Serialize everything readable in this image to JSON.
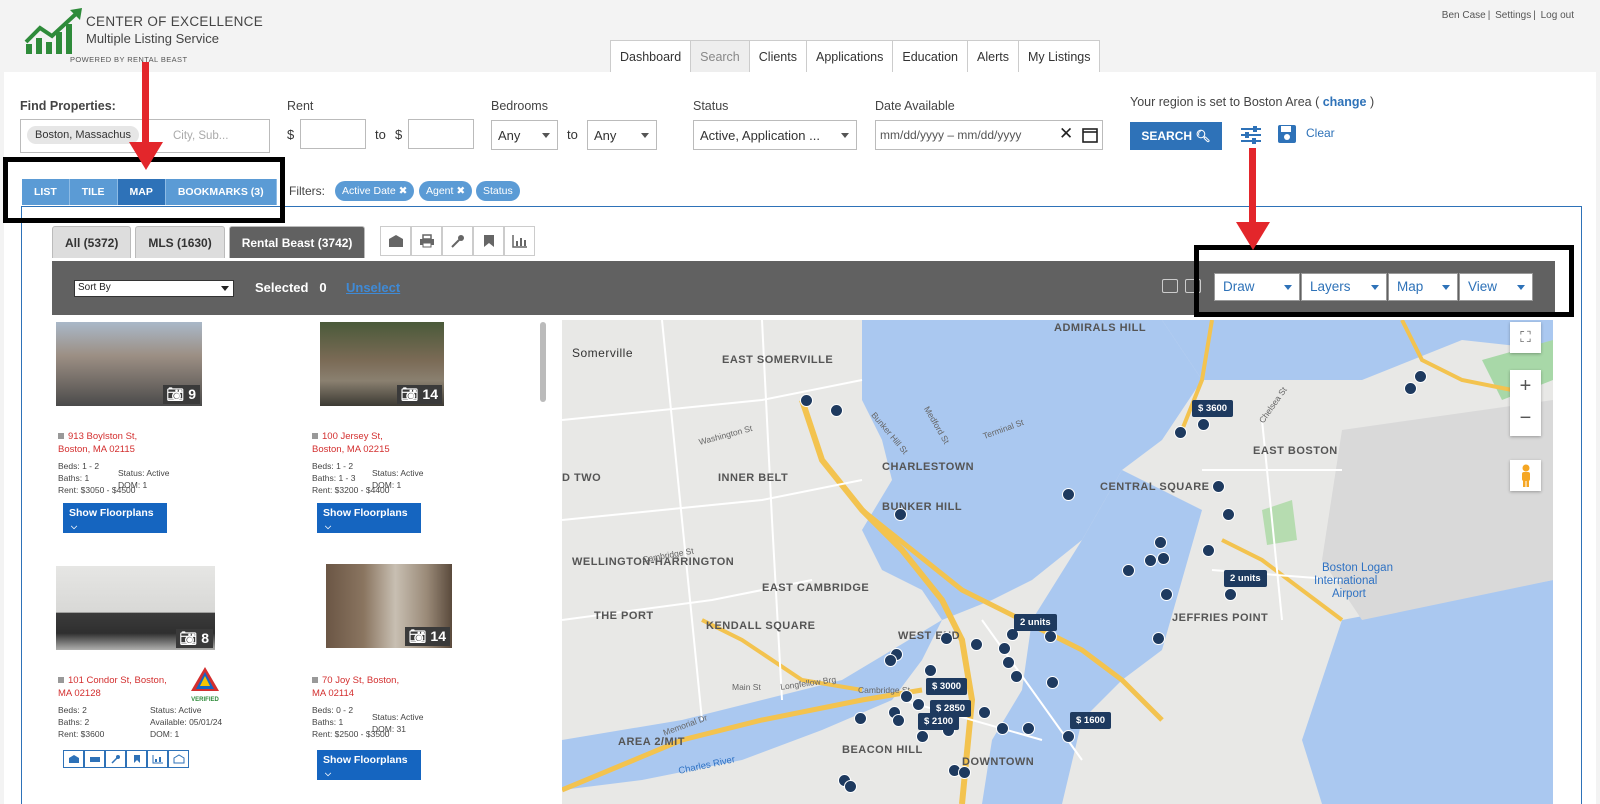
{
  "brand": {
    "name_line1": "CENTER OF EXCELLENCE",
    "name_line2": "Multiple Listing Service",
    "powered": "POWERED BY RENTAL BEAST"
  },
  "user_links": [
    "Ben Case",
    "Settings",
    "Log out"
  ],
  "nav_tabs": [
    "Dashboard",
    "Search",
    "Clients",
    "Applications",
    "Education",
    "Alerts",
    "My Listings"
  ],
  "search": {
    "find_label": "Find Properties:",
    "location_chip": "Boston, Massachus",
    "location_placeholder": "City, Sub...",
    "rent_label": "Rent",
    "currency": "$",
    "to": "to",
    "bedrooms_label": "Bedrooms",
    "bedrooms_min": "Any",
    "bedrooms_max": "Any",
    "status_label": "Status",
    "status_value": "Active, Application ...",
    "date_label": "Date Available",
    "date_placeholder": "mm/dd/yyyy – mm/dd/yyyy",
    "region_text": "Your region is set to Boston Area (",
    "region_link": "change",
    "region_close": ")",
    "search_button": "SEARCH",
    "clear": "Clear"
  },
  "view_tabs": [
    "LIST",
    "TILE",
    "MAP",
    "BOOKMARKS (3)"
  ],
  "filters": {
    "label": "Filters:",
    "chips": [
      "Active Date ✖",
      "Agent ✖",
      "Status"
    ]
  },
  "count_tabs": [
    "All (5372)",
    "MLS (1630)",
    "Rental Beast (3742)"
  ],
  "toolbar": {
    "sort_by": "Sort By",
    "selected": "Selected",
    "selected_count": "0",
    "unselect": "Unselect",
    "map_dropdowns": [
      "Draw",
      "Layers",
      "Map",
      "View"
    ]
  },
  "listings": [
    {
      "photos": "9",
      "address1": "913 Boylston St,",
      "address2": "Boston, MA 02115",
      "beds": "Beds: 1 - 2",
      "baths": "Baths: 1",
      "rent": "Rent: $3050 - $4500",
      "status": "Status: Active",
      "dom": "DOM: 1",
      "button": "Show Floorplans"
    },
    {
      "photos": "14",
      "address1": "100 Jersey St,",
      "address2": "Boston, MA 02215",
      "beds": "Beds: 1 - 2",
      "baths": "Baths: 1 - 3",
      "rent": "Rent: $3200 - $4400",
      "status": "Status: Active",
      "dom": "DOM: 1",
      "button": "Show Floorplans"
    },
    {
      "photos": "8",
      "address1": "101 Condor St, Boston,",
      "address2": "MA 02128",
      "beds": "Beds: 2",
      "baths": "Baths: 2",
      "rent": "Rent: $3600",
      "status": "Status: Active",
      "available": "Available: 05/01/24",
      "dom": "DOM: 1",
      "badge": "VERIFIED"
    },
    {
      "photos": "14",
      "address1": "70 Joy St, Boston,",
      "address2": "MA 02114",
      "beds": "Beds: 0 - 2",
      "baths": "Baths: 1",
      "rent": "Rent: $2500 - $3500",
      "status": "Status: Active",
      "dom": "DOM: 31",
      "button": "Show Floorplans"
    }
  ],
  "map": {
    "labels": [
      "Somerville",
      "EAST SOMERVILLE",
      "ADMIRALS HILL",
      "CHARLESTOWN",
      "INNER BELT",
      "BUNKER HILL",
      "EAST BOSTON",
      "CENTRAL SQUARE",
      "WELLINGTON-HARRINGTON",
      "EAST CAMBRIDGE",
      "THE PORT",
      "KENDALL SQUARE",
      "WEST END",
      "JEFFRIES POINT",
      "AREA 2/MIT",
      "BEACON HILL",
      "DOWNTOWN",
      "D TWO",
      "Boston Logan",
      "International",
      "Airport",
      "Charles River",
      "Main St",
      "Longfellow Brg",
      "Memorial Dr",
      "Cambridge St",
      "Medford St",
      "Terminal St",
      "Bunker Hill St",
      "Washington St",
      "Cambridge St",
      "Chelsea St"
    ],
    "price_tags": [
      "$ 3600",
      "2 units",
      "2 units",
      "$ 3000",
      "$ 2850",
      "$ 2100",
      "$ 1600"
    ]
  },
  "colors": {
    "primary": "#2e72b8",
    "tab_light": "#5b9bd5",
    "dark_bar": "#616161",
    "pin": "#1e3a5f",
    "address_red": "#d32f2f",
    "annotation_red": "#e3262b"
  }
}
